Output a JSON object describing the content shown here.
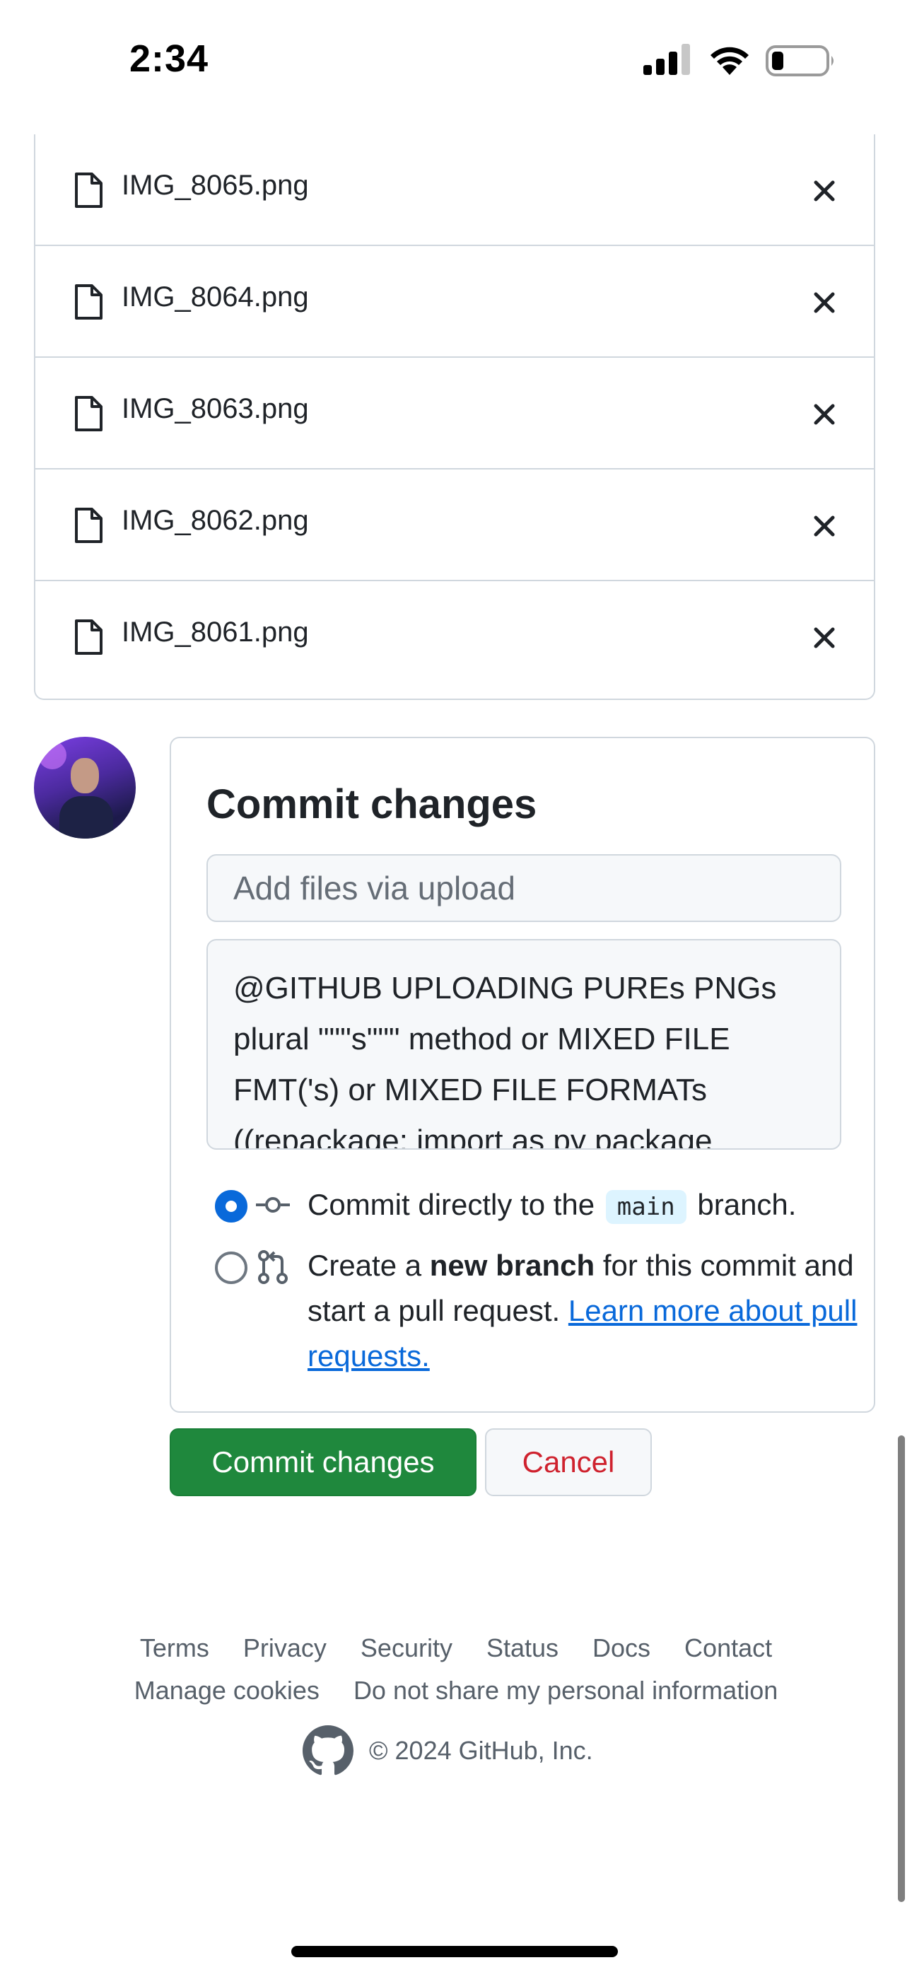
{
  "status_bar": {
    "time": "2:34"
  },
  "files": [
    {
      "name": "IMG_8065.png"
    },
    {
      "name": "IMG_8064.png"
    },
    {
      "name": "IMG_8063.png"
    },
    {
      "name": "IMG_8062.png"
    },
    {
      "name": "IMG_8061.png"
    }
  ],
  "commit": {
    "title": "Commit changes",
    "summary_placeholder": "Add files via upload",
    "description": "@GITHUB UPLOADING PUREs PNGs plural \"\"\"s\"\"\" method or MIXED FILE FMT('s) or MIXED FILE FORMATs ((repackage: import as py package",
    "option_direct": {
      "before": "Commit directly to the",
      "branch": "main",
      "after": "branch.",
      "selected": true
    },
    "option_new_branch": {
      "before": "Create a",
      "bold": "new branch",
      "after": "for this commit and start a pull request.",
      "link": "Learn more about pull requests.",
      "selected": false
    }
  },
  "buttons": {
    "commit_label": "Commit changes",
    "cancel_label": "Cancel"
  },
  "footer": {
    "links_row1": [
      "Terms",
      "Privacy",
      "Security",
      "Status",
      "Docs",
      "Contact"
    ],
    "links_row2": [
      "Manage cookies",
      "Do not share my personal information"
    ],
    "copyright": "© 2024 GitHub, Inc."
  },
  "colors": {
    "primary_button": "#1f883d",
    "cancel_text": "#cf222e",
    "link": "#0969da",
    "border": "#d0d7de"
  }
}
